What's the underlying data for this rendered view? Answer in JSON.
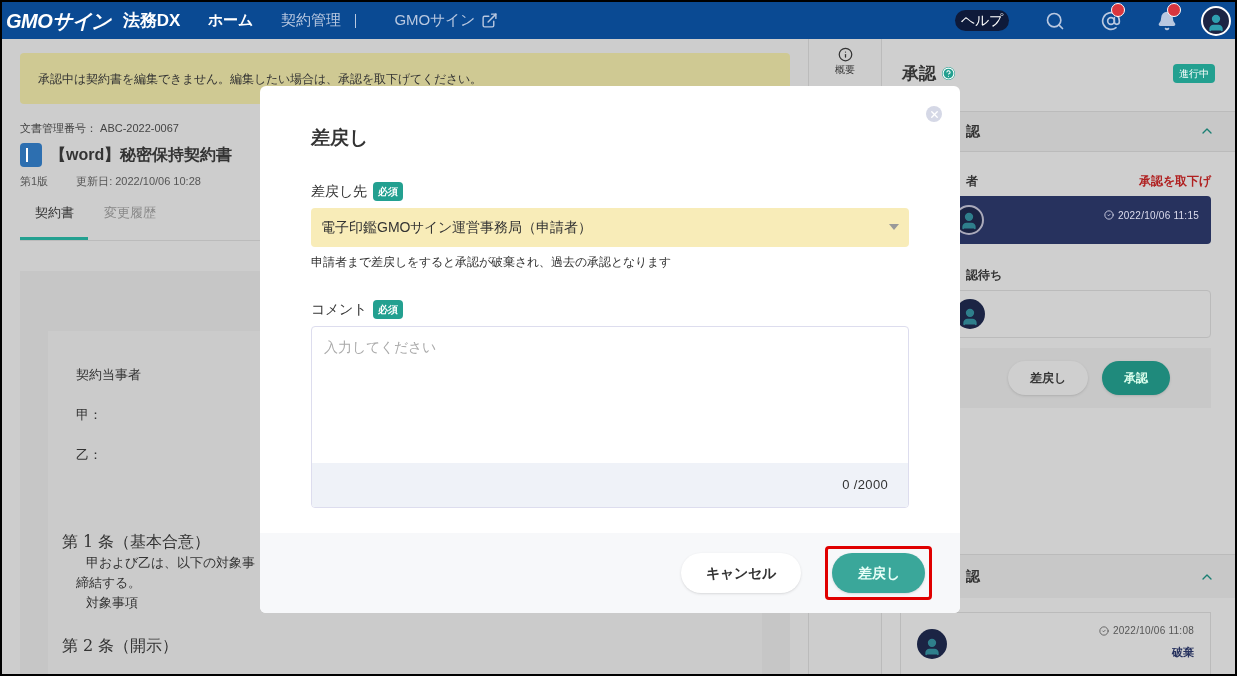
{
  "header": {
    "logo": "GMOサイン",
    "product": "法務DX",
    "nav": [
      {
        "label": "ホーム",
        "selected": true
      },
      {
        "label": "契約管理",
        "selected": false
      }
    ],
    "external_link": "GMOサイン",
    "help": "ヘルプ",
    "mention_badge": true,
    "bell_badge": true
  },
  "notice": "承認中は契約書を編集できません。編集したい場合は、承認を取下げてください。",
  "document": {
    "number": "文書管理番号： ABC-2022-0067",
    "title": "【word】秘密保持契約書",
    "version": "第1版",
    "updated": "更新日: 2022/10/06 10:28"
  },
  "tabs": [
    {
      "label": "契約書",
      "selected": true
    },
    {
      "label": "変更履歴",
      "selected": false
    }
  ],
  "paper": [
    {
      "kind": "line",
      "text": "契約当事者"
    },
    {
      "kind": "line",
      "text": "甲："
    },
    {
      "kind": "line_end",
      "text": "乙："
    },
    {
      "kind": "heading",
      "text": "第 1 条（基本合意）"
    },
    {
      "kind": "indent",
      "text": "甲および乙は、以下の対象事"
    },
    {
      "kind": "body",
      "text": "締結する。"
    },
    {
      "kind": "indent",
      "text": "対象事項"
    },
    {
      "kind": "heading",
      "text": "第 2 条（開示）"
    }
  ],
  "side_tab": "概要",
  "approval": {
    "title": "承認",
    "status": "進行中",
    "sections": [
      {
        "title": "認",
        "expanded": true
      },
      {
        "title": "認",
        "expanded": true
      }
    ],
    "approver_label": "者",
    "withdraw": "承認を取下げ",
    "approved_time": "2022/10/06 11:15",
    "waiting_label": "認待ち",
    "reject_button": "差戻し",
    "approve_button": "承認",
    "past_time": "2022/10/06 11:08",
    "past_status": "破棄"
  },
  "modal": {
    "title": "差戻し",
    "target_label": "差戻し先",
    "target_required": "必須",
    "target_value": "電子印鑑GMOサイン運営事務局（申請者）",
    "target_hint": "申請者まで差戻しをすると承認が破棄され、過去の承認となります",
    "comment_label": "コメント",
    "comment_required": "必須",
    "comment_placeholder": "入力してください",
    "counter": "0 /2000",
    "cancel": "キャンセル",
    "submit": "差戻し",
    "submit_highlighted": true
  }
}
